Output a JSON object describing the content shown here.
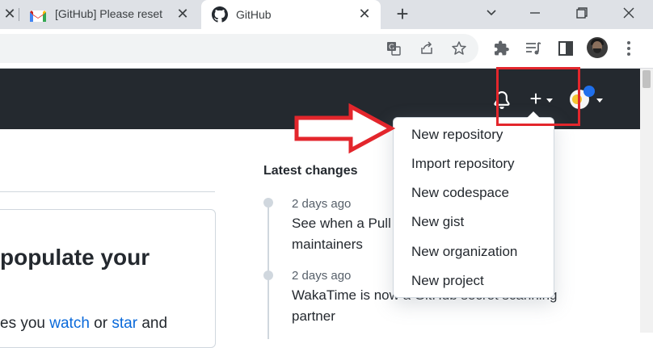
{
  "browser": {
    "tabs": [
      {
        "title": "",
        "active": false
      },
      {
        "title": "[GitHub] Please reset",
        "favicon": "gmail-icon",
        "active": false
      },
      {
        "title": "GitHub",
        "favicon": "github-icon",
        "active": true
      }
    ],
    "new_tab_label": "+",
    "window_controls": [
      "chevron-down-icon",
      "minimize-icon",
      "restore-icon",
      "close-icon"
    ],
    "toolbar_icons": [
      "translate-icon",
      "share-icon",
      "star-icon",
      "extensions-icon",
      "media-icon",
      "side-panel-icon",
      "profile-avatar",
      "menu-kebab-icon"
    ]
  },
  "gh_header": {
    "icons": [
      "bell-icon",
      "plus-icon",
      "avatar"
    ],
    "accent": "#24292f"
  },
  "dropdown": {
    "items": [
      {
        "label": "New repository"
      },
      {
        "label": "Import repository"
      },
      {
        "label": "New codespace"
      },
      {
        "label": "New gist"
      },
      {
        "label": "New organization"
      },
      {
        "label": "New project"
      }
    ]
  },
  "main": {
    "card_title": "populate your",
    "card_text_prefix": "es you ",
    "card_link_watch": "watch",
    "card_text_or": " or ",
    "card_link_star": "star",
    "card_text_and": " and"
  },
  "latest_changes": {
    "heading": "Latest changes",
    "entries": [
      {
        "time": "2 days ago",
        "text": "See when a Pull ... maintainers",
        "line1": "See when a Pull",
        "line2": "maintainers"
      },
      {
        "time": "2 days ago",
        "line1": "WakaTime is now a GitHub secret scanning",
        "line2": "partner"
      }
    ]
  },
  "annotations": {
    "highlight_color": "#e3262c",
    "arrow_color": "#e3262c"
  }
}
